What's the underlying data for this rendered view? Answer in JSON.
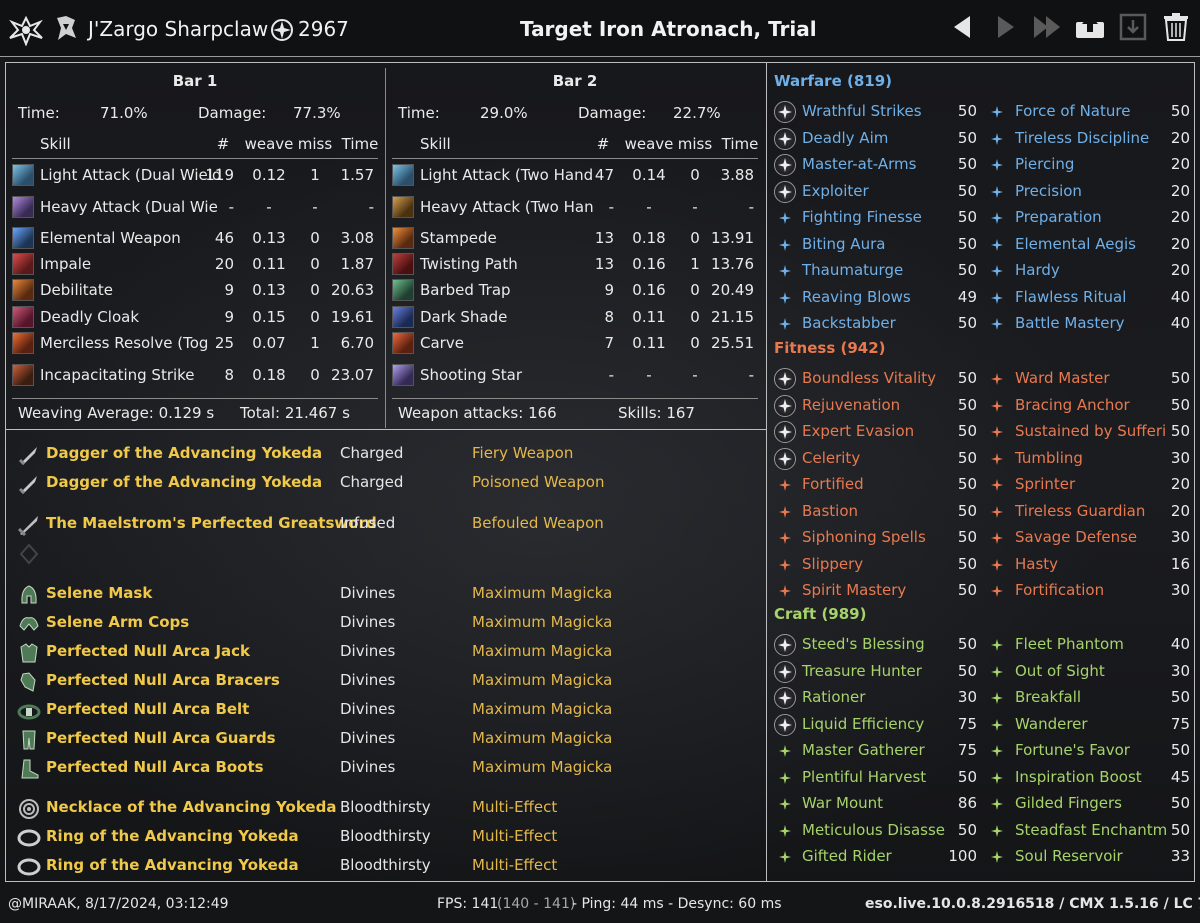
{
  "header": {
    "player": "J'Zargo Sharpclaw",
    "cp_total": "2967",
    "title": "Target Iron Atronach, Trial"
  },
  "bar1": {
    "title": "Bar 1",
    "time_label": "Time:",
    "time_value": "71.0%",
    "damage_label": "Damage:",
    "damage_value": "77.3%",
    "cols": [
      "Skill",
      "#",
      "weave",
      "miss",
      "Time"
    ],
    "rows": [
      {
        "skill": "Light Attack (Dual Wield",
        "n": "119",
        "weave": "0.12",
        "miss": "1",
        "time": "1.57"
      },
      {
        "skill": "Heavy Attack (Dual Wie",
        "n": "-",
        "weave": "-",
        "miss": "-",
        "time": "-"
      },
      {
        "skill": "Elemental Weapon",
        "n": "46",
        "weave": "0.13",
        "miss": "0",
        "time": "3.08"
      },
      {
        "skill": "Impale",
        "n": "20",
        "weave": "0.11",
        "miss": "0",
        "time": "1.87"
      },
      {
        "skill": "Debilitate",
        "n": "9",
        "weave": "0.13",
        "miss": "0",
        "time": "20.63"
      },
      {
        "skill": "Deadly Cloak",
        "n": "9",
        "weave": "0.15",
        "miss": "0",
        "time": "19.61"
      },
      {
        "skill": "Merciless Resolve (Tog",
        "n": "25",
        "weave": "0.07",
        "miss": "1",
        "time": "6.70"
      },
      {
        "skill": "Incapacitating Strike",
        "n": "8",
        "weave": "0.18",
        "miss": "0",
        "time": "23.07"
      }
    ],
    "footer_left": "Weaving Average:  0.129 s",
    "footer_right": "Total:  21.467 s"
  },
  "bar2": {
    "title": "Bar 2",
    "time_label": "Time:",
    "time_value": "29.0%",
    "damage_label": "Damage:",
    "damage_value": "22.7%",
    "cols": [
      "Skill",
      "#",
      "weave",
      "miss",
      "Time"
    ],
    "rows": [
      {
        "skill": "Light Attack (Two Hand",
        "n": "47",
        "weave": "0.14",
        "miss": "0",
        "time": "3.88"
      },
      {
        "skill": "Heavy Attack (Two Han",
        "n": "-",
        "weave": "-",
        "miss": "-",
        "time": "-"
      },
      {
        "skill": "Stampede",
        "n": "13",
        "weave": "0.18",
        "miss": "0",
        "time": "13.91"
      },
      {
        "skill": "Twisting Path",
        "n": "13",
        "weave": "0.16",
        "miss": "1",
        "time": "13.76"
      },
      {
        "skill": "Barbed Trap",
        "n": "9",
        "weave": "0.16",
        "miss": "0",
        "time": "20.49"
      },
      {
        "skill": "Dark Shade",
        "n": "8",
        "weave": "0.11",
        "miss": "0",
        "time": "21.15"
      },
      {
        "skill": "Carve",
        "n": "7",
        "weave": "0.11",
        "miss": "0",
        "time": "25.51"
      },
      {
        "skill": "Shooting Star",
        "n": "-",
        "weave": "-",
        "miss": "-",
        "time": "-"
      }
    ],
    "footer_left": "Weapon attacks:  166",
    "footer_right": "Skills:  167"
  },
  "gear": [
    {
      "name": "Dagger of the Advancing Yokeda",
      "trait": "Charged",
      "ench": "Fiery Weapon",
      "icon": "dagger-icon"
    },
    {
      "name": "Dagger of the Advancing Yokeda",
      "trait": "Charged",
      "ench": "Poisoned Weapon",
      "icon": "dagger-icon"
    },
    {
      "name": "The Maelstrom's Perfected Greatsword",
      "trait": "Infused",
      "ench": "Befouled Weapon",
      "icon": "greatsword-icon"
    },
    {
      "name": "",
      "trait": "",
      "ench": "",
      "icon": "empty-slot-icon"
    },
    {
      "name": "Selene Mask",
      "trait": "Divines",
      "ench": "Maximum Magicka",
      "icon": "helmet-icon"
    },
    {
      "name": "Selene Arm Cops",
      "trait": "Divines",
      "ench": "Maximum Magicka",
      "icon": "shoulders-icon"
    },
    {
      "name": "Perfected Null Arca Jack",
      "trait": "Divines",
      "ench": "Maximum Magicka",
      "icon": "chest-icon"
    },
    {
      "name": "Perfected Null Arca Bracers",
      "trait": "Divines",
      "ench": "Maximum Magicka",
      "icon": "gloves-icon"
    },
    {
      "name": "Perfected Null Arca Belt",
      "trait": "Divines",
      "ench": "Maximum Magicka",
      "icon": "belt-icon"
    },
    {
      "name": "Perfected Null Arca Guards",
      "trait": "Divines",
      "ench": "Maximum Magicka",
      "icon": "legs-icon"
    },
    {
      "name": "Perfected Null Arca Boots",
      "trait": "Divines",
      "ench": "Maximum Magicka",
      "icon": "boots-icon"
    },
    {
      "name": "Necklace of the Advancing Yokeda",
      "trait": "Bloodthirsty",
      "ench": "Multi-Effect",
      "icon": "necklace-icon"
    },
    {
      "name": "Ring of the Advancing Yokeda",
      "trait": "Bloodthirsty",
      "ench": "Multi-Effect",
      "icon": "ring-icon"
    },
    {
      "name": "Ring of the Advancing Yokeda",
      "trait": "Bloodthirsty",
      "ench": "Multi-Effect",
      "icon": "ring-icon"
    }
  ],
  "cp": {
    "warfare": {
      "title": "Warfare (819)",
      "color": "#6fb0e8",
      "left": [
        {
          "name": "Wrathful Strikes",
          "val": "50",
          "slotted": true
        },
        {
          "name": "Deadly Aim",
          "val": "50",
          "slotted": true
        },
        {
          "name": "Master-at-Arms",
          "val": "50",
          "slotted": true
        },
        {
          "name": "Exploiter",
          "val": "50",
          "slotted": true
        },
        {
          "name": "Fighting Finesse",
          "val": "50",
          "slotted": false
        },
        {
          "name": "Biting Aura",
          "val": "50",
          "slotted": false
        },
        {
          "name": "Thaumaturge",
          "val": "50",
          "slotted": false
        },
        {
          "name": "Reaving Blows",
          "val": "49",
          "slotted": false
        },
        {
          "name": "Backstabber",
          "val": "50",
          "slotted": false
        }
      ],
      "right": [
        {
          "name": "Force of Nature",
          "val": "50"
        },
        {
          "name": "Tireless Discipline",
          "val": "20"
        },
        {
          "name": "Piercing",
          "val": "20"
        },
        {
          "name": "Precision",
          "val": "20"
        },
        {
          "name": "Preparation",
          "val": "20"
        },
        {
          "name": "Elemental Aegis",
          "val": "20"
        },
        {
          "name": "Hardy",
          "val": "20"
        },
        {
          "name": "Flawless Ritual",
          "val": "40"
        },
        {
          "name": "Battle Mastery",
          "val": "40"
        }
      ]
    },
    "fitness": {
      "title": "Fitness (942)",
      "color": "#e8794f",
      "left": [
        {
          "name": "Boundless Vitality",
          "val": "50",
          "slotted": true
        },
        {
          "name": "Rejuvenation",
          "val": "50",
          "slotted": true
        },
        {
          "name": "Expert Evasion",
          "val": "50",
          "slotted": true
        },
        {
          "name": "Celerity",
          "val": "50",
          "slotted": true
        },
        {
          "name": "Fortified",
          "val": "50",
          "slotted": false
        },
        {
          "name": "Bastion",
          "val": "50",
          "slotted": false
        },
        {
          "name": "Siphoning Spells",
          "val": "50",
          "slotted": false
        },
        {
          "name": "Slippery",
          "val": "50",
          "slotted": false
        },
        {
          "name": "Spirit Mastery",
          "val": "50",
          "slotted": false
        }
      ],
      "right": [
        {
          "name": "Ward Master",
          "val": "50"
        },
        {
          "name": "Bracing Anchor",
          "val": "50"
        },
        {
          "name": "Sustained by Sufferi",
          "val": "50"
        },
        {
          "name": "Tumbling",
          "val": "30"
        },
        {
          "name": "Sprinter",
          "val": "20"
        },
        {
          "name": "Tireless Guardian",
          "val": "20"
        },
        {
          "name": "Savage Defense",
          "val": "30"
        },
        {
          "name": "Hasty",
          "val": "16"
        },
        {
          "name": "Fortification",
          "val": "30"
        }
      ]
    },
    "craft": {
      "title": "Craft (989)",
      "color": "#a6d36a",
      "left": [
        {
          "name": "Steed's Blessing",
          "val": "50",
          "slotted": true
        },
        {
          "name": "Treasure Hunter",
          "val": "50",
          "slotted": true
        },
        {
          "name": "Rationer",
          "val": "30",
          "slotted": true
        },
        {
          "name": "Liquid Efficiency",
          "val": "75",
          "slotted": true
        },
        {
          "name": "Master Gatherer",
          "val": "75",
          "slotted": false
        },
        {
          "name": "Plentiful Harvest",
          "val": "50",
          "slotted": false
        },
        {
          "name": "War Mount",
          "val": "86",
          "slotted": false
        },
        {
          "name": "Meticulous Disasse",
          "val": "50",
          "slotted": false
        },
        {
          "name": "Gifted Rider",
          "val": "100",
          "slotted": false
        }
      ],
      "right": [
        {
          "name": "Fleet Phantom",
          "val": "40"
        },
        {
          "name": "Out of Sight",
          "val": "30"
        },
        {
          "name": "Breakfall",
          "val": "50"
        },
        {
          "name": "Wanderer",
          "val": "75"
        },
        {
          "name": "Fortune's Favor",
          "val": "50"
        },
        {
          "name": "Inspiration Boost",
          "val": "45"
        },
        {
          "name": "Gilded Fingers",
          "val": "50"
        },
        {
          "name": "Steadfast Enchantm",
          "val": "50"
        },
        {
          "name": "Soul Reservoir",
          "val": "33"
        }
      ]
    }
  },
  "footer": {
    "left": "@MIRAAK, 8/17/2024, 03:12:49",
    "fps": "FPS: 141",
    "fps_range": "(140 - 141)",
    "ping": "- Ping: 44 ms - Desync: 60 ms",
    "right": "eso.live.10.0.8.2916518 / CMX 1.5.16 / LC 74"
  }
}
